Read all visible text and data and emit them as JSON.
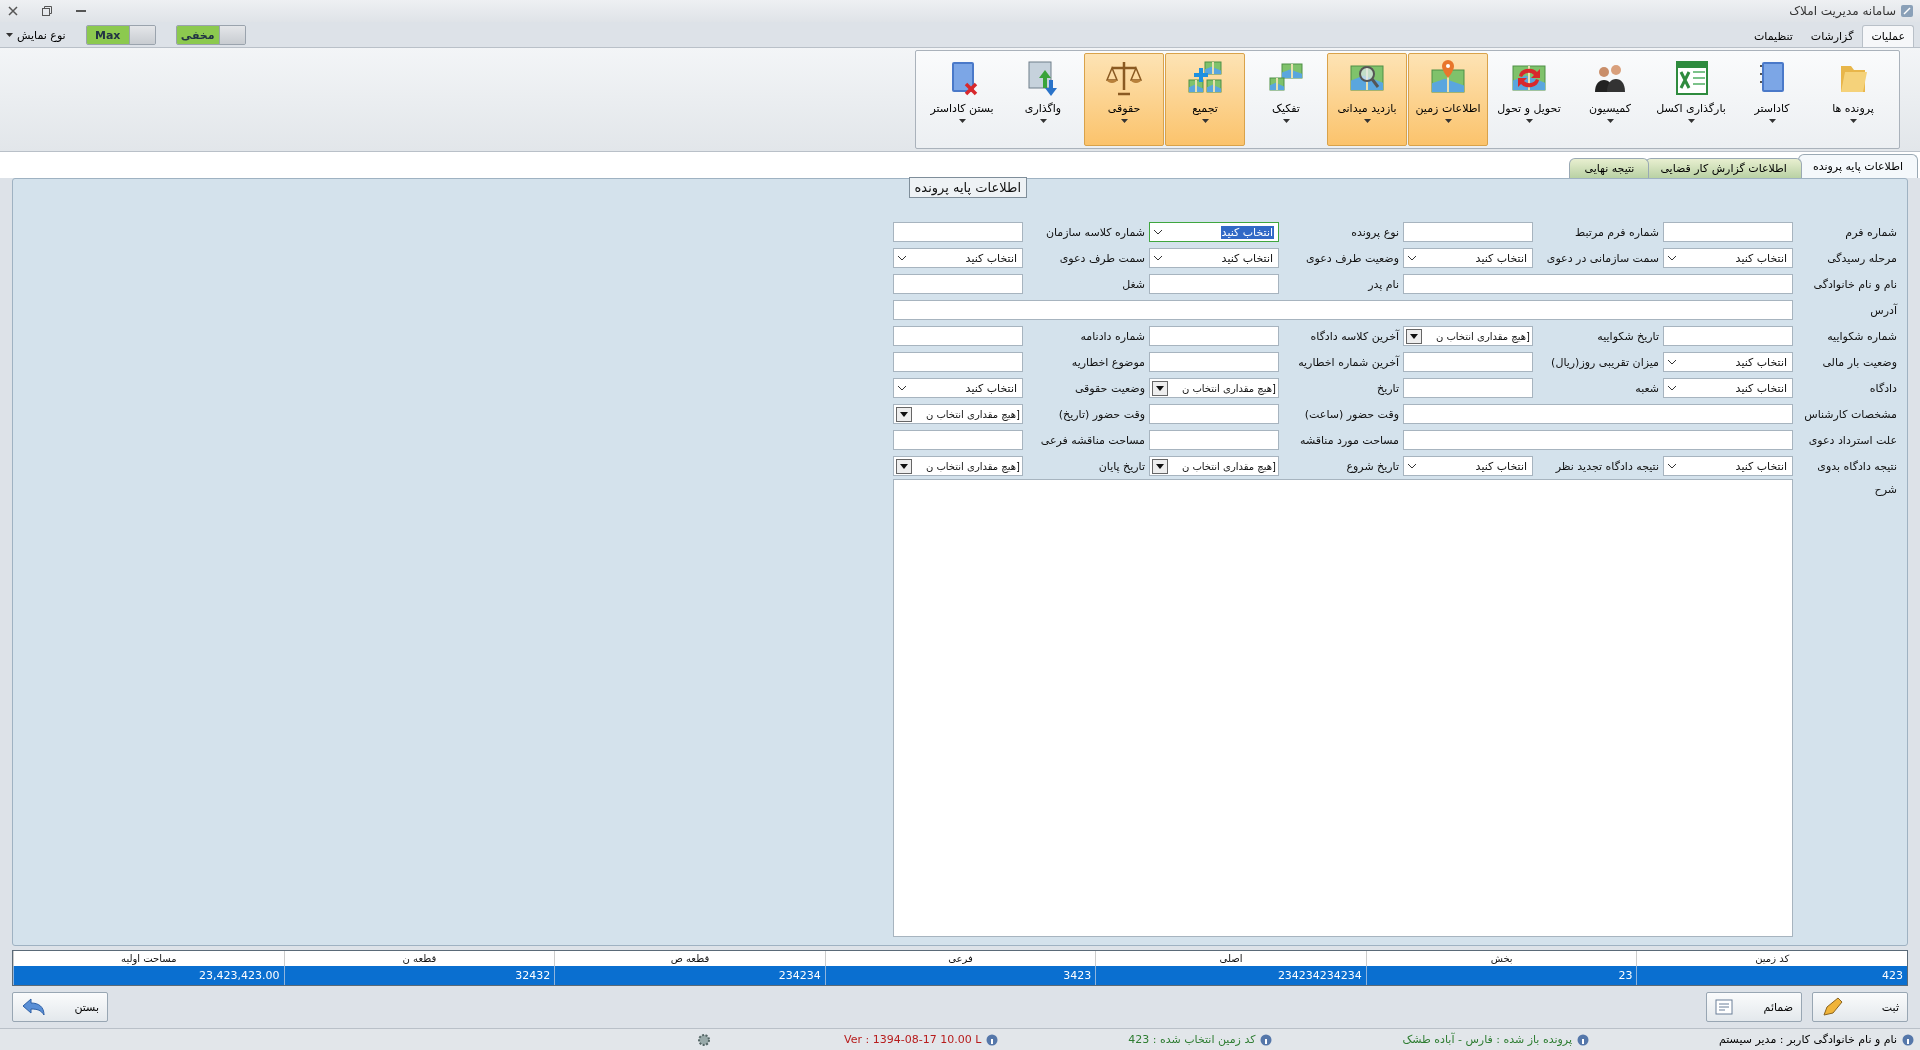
{
  "window": {
    "title": "سامانه مدیریت املاک"
  },
  "menu_tabs": [
    {
      "label": "عملیات",
      "selected": true
    },
    {
      "label": "گزارشات",
      "selected": false
    },
    {
      "label": "تنظیمات",
      "selected": false
    }
  ],
  "display_menu": {
    "label": "نوع نمایش"
  },
  "toggles": [
    {
      "label": "مخفی",
      "on": true
    },
    {
      "label": "Max",
      "on": true
    }
  ],
  "ribbon": [
    {
      "label": "پرونده ها",
      "highlighted": false
    },
    {
      "label": "کاداستر",
      "highlighted": false
    },
    {
      "label": "بارگذاری اکسل",
      "highlighted": false
    },
    {
      "label": "کمیسیون",
      "highlighted": false
    },
    {
      "label": "تحویل و تحول",
      "highlighted": false
    },
    {
      "label": "اطلاعات زمین",
      "highlighted": true
    },
    {
      "label": "بازدید میدانی",
      "highlighted": true
    },
    {
      "label": "تفکیک",
      "highlighted": false
    },
    {
      "label": "تجمیع",
      "highlighted": true
    },
    {
      "label": "حقوقی",
      "highlighted": true
    },
    {
      "label": "واگذاری",
      "highlighted": false
    },
    {
      "label": "بستن کاداستر",
      "highlighted": false
    }
  ],
  "page_tabs": [
    {
      "label": "اطلاعات پایه پرونده",
      "selected": true
    },
    {
      "label": "اطلاعات گزارش کار قضایی",
      "selected": false
    },
    {
      "label": "نتیجه نهایی",
      "selected": false
    }
  ],
  "group_title": "اطلاعات پایه پرونده",
  "fields": [
    {
      "label": "شماره فرم",
      "kind": "text"
    },
    {
      "label": "شماره فرم مرتبط",
      "kind": "text"
    },
    {
      "label": "نوع پرونده",
      "kind": "select",
      "value": "انتخاب کنید",
      "focused": true
    },
    {
      "label": "شماره کلاسه سازمان",
      "kind": "text"
    },
    {
      "label": "مرحله رسیدگی",
      "kind": "select",
      "value": "انتخاب کنید",
      "focused": false
    },
    {
      "label": "سمت سازمانی در دعوی",
      "kind": "select",
      "value": "انتخاب کنید",
      "focused": false
    },
    {
      "label": "وضعیت طرف دعوی",
      "kind": "select",
      "value": "انتخاب کنید",
      "focused": false
    },
    {
      "label": "سمت طرف دعوی",
      "kind": "select",
      "value": "انتخاب کنید",
      "focused": false
    },
    {
      "label": "نام و نام خانوادگی",
      "kind": "wide"
    },
    {
      "label": "نام پدر",
      "kind": "text"
    },
    {
      "label": "شغل",
      "kind": "text"
    },
    {
      "label": "آدرس",
      "kind": "full"
    },
    {
      "label": "شماره شکواییه",
      "kind": "text"
    },
    {
      "label": "تاریخ شکواییه",
      "kind": "date",
      "value": "[هیچ مقداری انتخاب ن"
    },
    {
      "label": "آخرین کلاسه دادگاه",
      "kind": "text"
    },
    {
      "label": "شماره دادنامه",
      "kind": "text"
    },
    {
      "label": "وضعیت بار مالی",
      "kind": "select",
      "value": "انتخاب کنید",
      "focused": false
    },
    {
      "label": "میزان تقریبی روز(ریال)",
      "kind": "text"
    },
    {
      "label": "آخرین شماره اخطاریه",
      "kind": "text"
    },
    {
      "label": "موضوع اخطاریه",
      "kind": "text"
    },
    {
      "label": "دادگاه",
      "kind": "select",
      "value": "انتخاب کنید",
      "focused": false
    },
    {
      "label": "شعبه",
      "kind": "text"
    },
    {
      "label": "تاریخ",
      "kind": "date",
      "value": "[هیچ مقداری انتخاب ن"
    },
    {
      "label": "وضعیت حقوقی",
      "kind": "select",
      "value": "انتخاب کنید",
      "focused": false
    },
    {
      "label": "مشخصات کارشناس",
      "kind": "wide"
    },
    {
      "label": "وقت حضور (ساعت)",
      "kind": "text"
    },
    {
      "label": "وقت حضور (تاریخ)",
      "kind": "date",
      "value": "[هیچ مقداری انتخاب ن"
    },
    {
      "label": "علت استرداد دعوی",
      "kind": "wide"
    },
    {
      "label": "مساحت مورد مناقشه",
      "kind": "text"
    },
    {
      "label": "مساحت مناقشه فرعی",
      "kind": "text"
    },
    {
      "label": "نتیجه دادگاه بدوی",
      "kind": "select",
      "value": "انتخاب کنید",
      "focused": false
    },
    {
      "label": "نتیجه دادگاه تجدید نظر",
      "kind": "select",
      "value": "انتخاب کنید",
      "focused": false
    },
    {
      "label": "تاریخ شروع",
      "kind": "date",
      "value": "[هیچ مقداری انتخاب ن"
    },
    {
      "label": "تاریخ پایان",
      "kind": "date",
      "value": "[هیچ مقداری انتخاب ن"
    },
    {
      "label": "شرح",
      "kind": "memo"
    }
  ],
  "table": {
    "columns": [
      "کد زمین",
      "بخش",
      "اصلی",
      "فرعی",
      "قطعه ص",
      "قطعه ن",
      "مساحت اولیه"
    ],
    "rows": [
      {
        "selected": true,
        "cells": [
          "423",
          "23",
          "234234234234",
          "3423",
          "234234",
          "32432",
          "23,423,423.00"
        ]
      }
    ]
  },
  "actions": [
    {
      "label": "ثبت"
    },
    {
      "label": "ضمائم"
    }
  ],
  "close_button": {
    "label": "بستن"
  },
  "status_bar": [
    {
      "text": "نام و نام خانوادگی کاربر :  مدیر سیستم",
      "color": "#000000"
    },
    {
      "text": "پرونده باز شده : فارس - آباده طشک",
      "color": "#2e7d32"
    },
    {
      "text": "کد زمین انتخاب شده : 423",
      "color": "#2e7d32"
    },
    {
      "text": "Ver : 1394-08-17 10.00 L",
      "color": "#b71c1c"
    }
  ]
}
